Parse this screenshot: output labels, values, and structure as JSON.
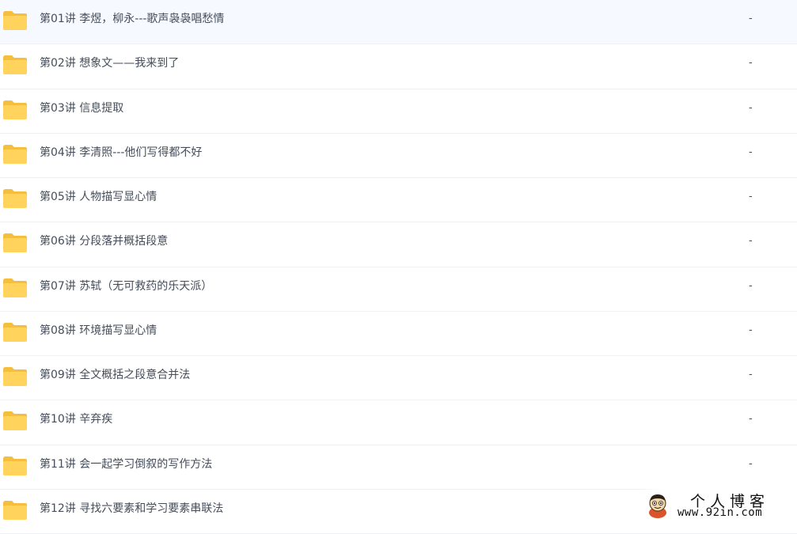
{
  "files": [
    {
      "name": "第01讲 李煜，柳永---歌声袅袅唱愁情",
      "size": "-",
      "icon": "folder-icon"
    },
    {
      "name": "第02讲 想象文——我来到了",
      "size": "-",
      "icon": "folder-icon"
    },
    {
      "name": "第03讲 信息提取",
      "size": "-",
      "icon": "folder-icon"
    },
    {
      "name": "第04讲 李清照---他们写得都不好",
      "size": "-",
      "icon": "folder-icon"
    },
    {
      "name": "第05讲 人物描写显心情",
      "size": "-",
      "icon": "folder-icon"
    },
    {
      "name": "第06讲 分段落并概括段意",
      "size": "-",
      "icon": "folder-icon"
    },
    {
      "name": "第07讲 苏轼（无可救药的乐天派）",
      "size": "-",
      "icon": "folder-icon"
    },
    {
      "name": "第08讲 环境描写显心情",
      "size": "-",
      "icon": "folder-icon"
    },
    {
      "name": "第09讲 全文概括之段意合并法",
      "size": "-",
      "icon": "folder-icon"
    },
    {
      "name": "第10讲 辛弃疾",
      "size": "-",
      "icon": "folder-icon"
    },
    {
      "name": "第11讲 会一起学习倒叙的写作方法",
      "size": "-",
      "icon": "folder-icon"
    },
    {
      "name": "第12讲 寻找六要素和学习要素串联法",
      "size": "",
      "icon": "folder-icon"
    }
  ],
  "watermark": {
    "title": "个人博客",
    "url": "www.92in.com",
    "logo": "cartoon-avatar-logo"
  },
  "colors": {
    "folder": "#ffd35c",
    "folder_tab": "#f5be3c",
    "text": "#454d5a",
    "divider": "#eef0f3"
  }
}
